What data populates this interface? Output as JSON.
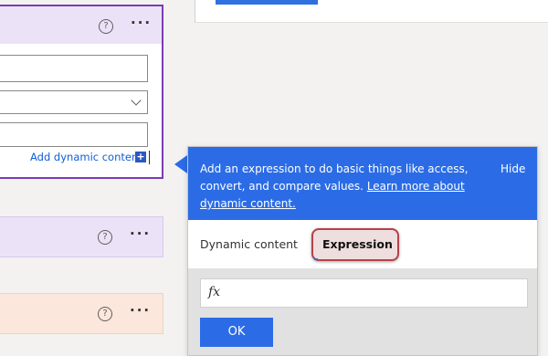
{
  "action_card": {
    "help_glyph": "?",
    "more_glyph": "···",
    "dropdown_icon": "chevron-down-icon",
    "add_dynamic_content": "Add dynamic content",
    "add_icon_glyph": "+"
  },
  "collapsed_cards": [
    {
      "help_glyph": "?",
      "more_glyph": "···"
    },
    {
      "help_glyph": "?",
      "more_glyph": "···"
    }
  ],
  "popup": {
    "info_text": "Add an expression to do basic things like access, convert, and compare values.",
    "learn_more": "Learn more about dynamic content.",
    "hide": "Hide",
    "tabs": {
      "dynamic": "Dynamic content",
      "expression": "Expression"
    },
    "expression_placeholder": "",
    "fx_glyph": "fx",
    "ok": "OK"
  },
  "colors": {
    "accent": "#2b6ce6",
    "card_border": "#7a3cb5",
    "card_header": "#ebe2f7",
    "peach_card": "#fbe7dc",
    "highlight": "#b54249"
  }
}
